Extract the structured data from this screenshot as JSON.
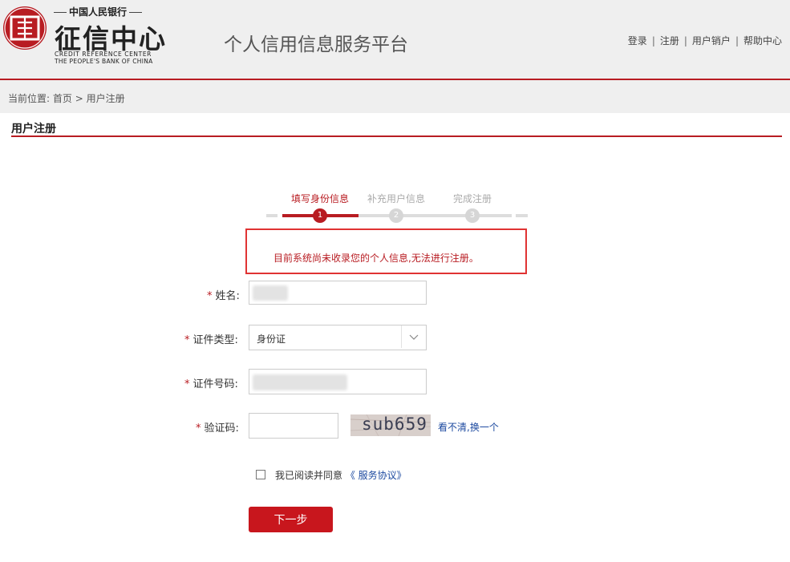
{
  "header": {
    "logo_bank_text": "中国人民银行",
    "logo_name": "征信中心",
    "logo_en_line1": "CREDIT REFERENCE CENTER",
    "logo_en_line2": "THE PEOPLE'S BANK OF CHINA",
    "platform_title": "个人信用信息服务平台",
    "links": [
      "登录",
      "注册",
      "用户销户",
      "帮助中心"
    ],
    "brand_color": "#b81c22"
  },
  "breadcrumb": {
    "prefix": "当前位置:",
    "home": "首页",
    "separator": ">",
    "current": "用户注册"
  },
  "page_title": "用户注册",
  "steps": {
    "items": [
      {
        "label": "填写身份信息",
        "number": "1",
        "active": true
      },
      {
        "label": "补充用户信息",
        "number": "2",
        "active": false
      },
      {
        "label": "完成注册",
        "number": "3",
        "active": false
      }
    ]
  },
  "alert": {
    "message": "目前系统尚未收录您的个人信息,无法进行注册。"
  },
  "form": {
    "required_mark": "*",
    "name_label": "姓名:",
    "id_type_label": "证件类型:",
    "id_type_value": "身份证",
    "id_number_label": "证件号码:",
    "captcha_label": "验证码:",
    "captcha_text": "sub659",
    "captcha_refresh": "看不清,换一个",
    "agree_prefix": "我已阅读并同意",
    "agree_link": "《 服务协议》",
    "next_button": "下一步"
  }
}
